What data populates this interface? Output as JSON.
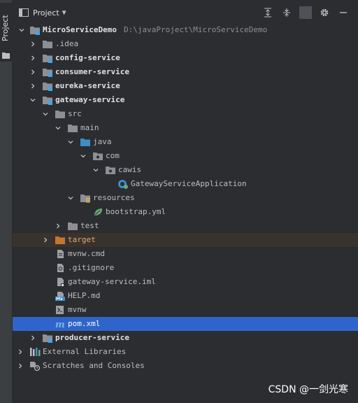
{
  "sidebar": {
    "tab_label": "Project"
  },
  "header": {
    "title": "Project",
    "caret": "▼"
  },
  "tree": {
    "root": {
      "label": "MicroServiceDemo",
      "path": "D:\\javaProject\\MicroServiceDemo"
    },
    "idea": ".idea",
    "config_service": "config-service",
    "consumer_service": "consumer-service",
    "eureka_service": "eureka-service",
    "gateway_service": "gateway-service",
    "src": "src",
    "main": "main",
    "java": "java",
    "com": "com",
    "cawis": "cawis",
    "app_class": "GatewayServiceApplication",
    "resources": "resources",
    "bootstrap": "bootstrap.yml",
    "test": "test",
    "target": "target",
    "mvnw_cmd": "mvnw.cmd",
    "gitignore": ".gitignore",
    "iml": "gateway-service.iml",
    "help_md": "HELP.md",
    "mvnw": "mvnw",
    "pom": "pom.xml",
    "producer_service": "producer-service",
    "external_libraries": "External Libraries",
    "scratches": "Scratches and Consoles"
  },
  "watermark": "CSDN @一剑光寒",
  "colors": {
    "background": "#2b2d30",
    "selection": "#2f65ca",
    "folder": "#8c9096",
    "source_folder": "#3d8fc9",
    "module_badge": "#4aa3df",
    "excluded": "#c57633",
    "spring": "#6aab73"
  }
}
